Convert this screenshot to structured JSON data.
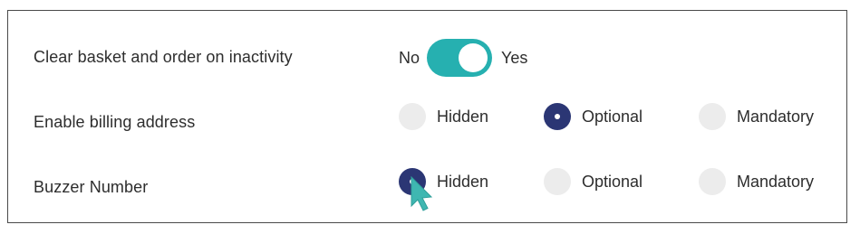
{
  "settings": {
    "rows": [
      {
        "label": "Clear basket and order on inactivity",
        "type": "toggle",
        "off_label": "No",
        "on_label": "Yes",
        "value": "Yes"
      },
      {
        "label": "Enable billing address",
        "type": "radio",
        "options": [
          "Hidden",
          "Optional",
          "Mandatory"
        ],
        "selected": "Optional"
      },
      {
        "label": "Buzzer Number",
        "type": "radio",
        "options": [
          "Hidden",
          "Optional",
          "Mandatory"
        ],
        "selected": "Hidden"
      }
    ]
  },
  "colors": {
    "toggle_on": "#26b0b0",
    "radio_selected": "#2b3674",
    "radio_unselected": "#ececec",
    "cursor": "#3fb7b1"
  },
  "icons": {
    "cursor": "mouse-pointer-icon"
  }
}
